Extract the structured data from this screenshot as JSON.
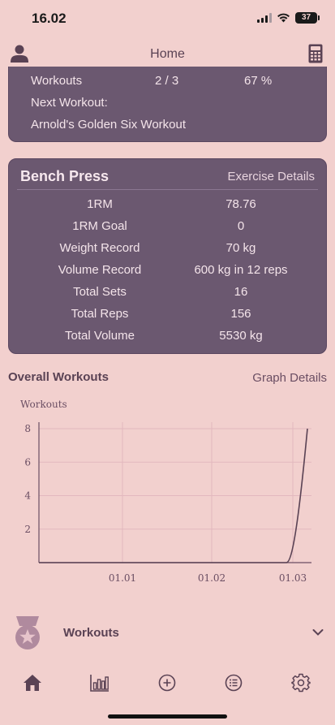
{
  "status_bar": {
    "time": "16.02",
    "battery": "37"
  },
  "header": {
    "title": "Home"
  },
  "summary_card": {
    "workouts_label": "Workouts",
    "workouts_count": "2 / 3",
    "workouts_percent": "67 %",
    "next_workout_label": "Next Workout:",
    "next_workout_name": "Arnold's Golden Six Workout"
  },
  "exercise_card": {
    "title": "Bench Press",
    "details_link": "Exercise Details",
    "stats": [
      {
        "label": "1RM",
        "value": "78.76"
      },
      {
        "label": "1RM Goal",
        "value": "0"
      },
      {
        "label": "Weight Record",
        "value": "70 kg"
      },
      {
        "label": "Volume Record",
        "value": "600 kg in 12 reps"
      },
      {
        "label": "Total Sets",
        "value": "16"
      },
      {
        "label": "Total Reps",
        "value": "156"
      },
      {
        "label": "Total Volume",
        "value": "5530 kg"
      }
    ]
  },
  "overall": {
    "title": "Overall Workouts",
    "details_link": "Graph Details"
  },
  "chart_data": {
    "type": "line",
    "ylabel": "Workouts",
    "xlabel": "",
    "y_ticks": [
      "2",
      "4",
      "6",
      "8"
    ],
    "x_ticks": [
      "01.01",
      "01.02",
      "01.03"
    ],
    "ylim": [
      0,
      8
    ],
    "grid": true,
    "series": [
      {
        "x": [
          "01.03",
          "end"
        ],
        "values": [
          0,
          8
        ]
      }
    ]
  },
  "workouts_section": {
    "label": "Workouts"
  },
  "colors": {
    "background": "#f2d0ce",
    "card": "#6b5870",
    "accent": "#6b4e63"
  },
  "tabs": [
    {
      "icon": "home-icon"
    },
    {
      "icon": "bar-chart-icon"
    },
    {
      "icon": "plus-circle-icon"
    },
    {
      "icon": "list-icon"
    },
    {
      "icon": "gear-icon"
    }
  ]
}
